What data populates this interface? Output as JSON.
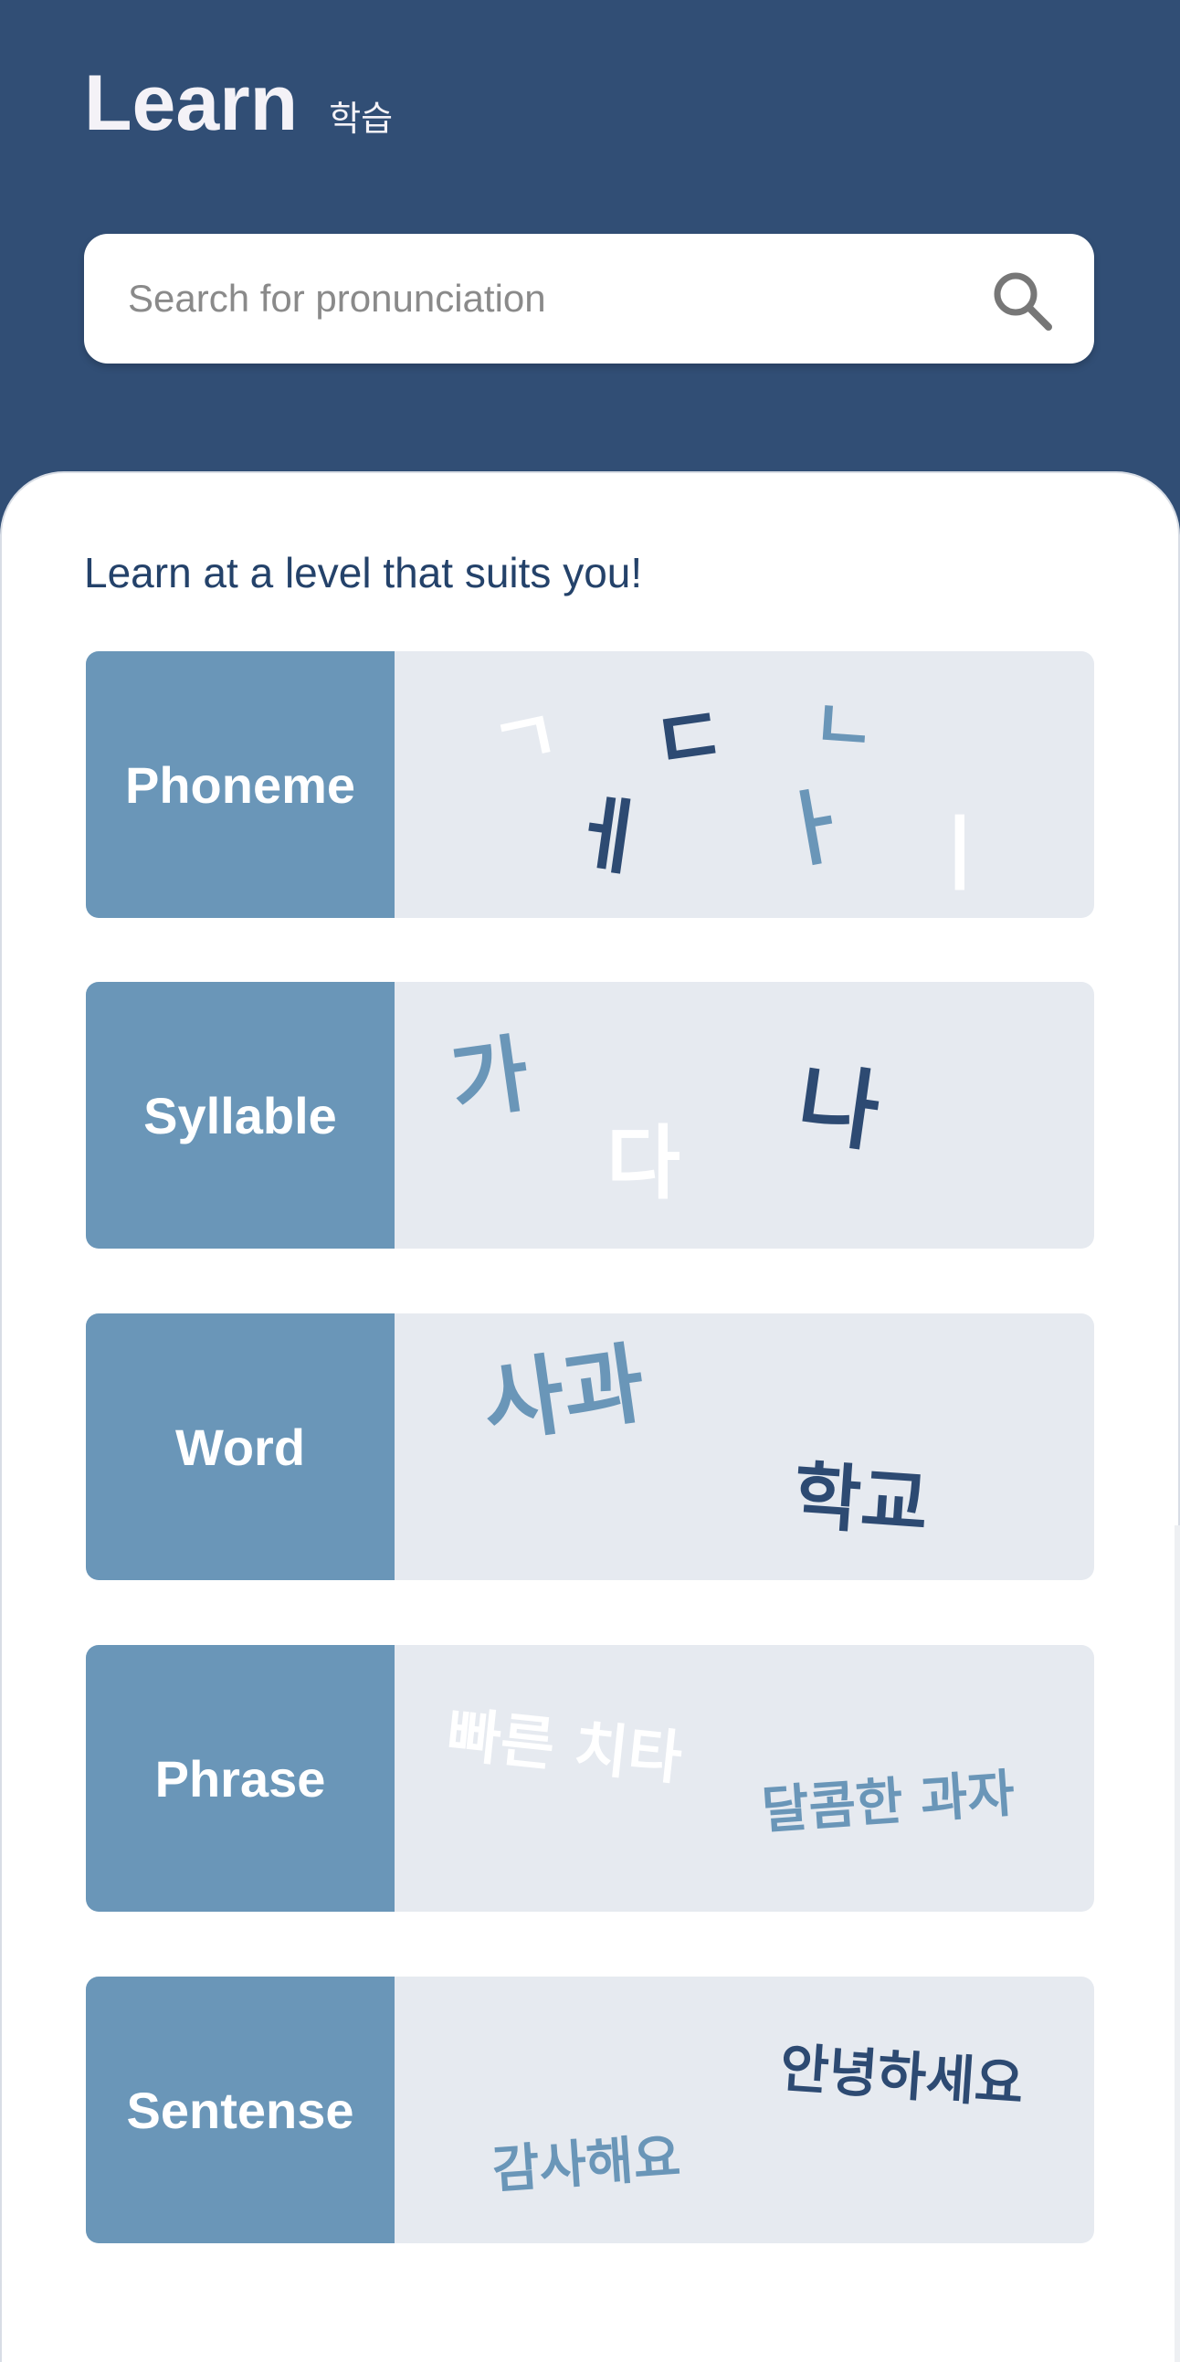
{
  "header": {
    "title": "Learn",
    "title_korean": "학습"
  },
  "search": {
    "placeholder": "Search for pronunciation",
    "icon": "search-icon"
  },
  "subtitle": "Learn at a level that suits you!",
  "cards": [
    {
      "label": "Phoneme",
      "glyphs": [
        "ㄱ",
        "ㄷ",
        "ㄴ",
        "ㅔ",
        "ㅏ",
        "ㅣ"
      ]
    },
    {
      "label": "Syllable",
      "glyphs": [
        "가",
        "다",
        "나"
      ]
    },
    {
      "label": "Word",
      "glyphs": [
        "사과",
        "학교"
      ]
    },
    {
      "label": "Phrase",
      "glyphs": [
        "빠른 치타",
        "달콤한 과자"
      ]
    },
    {
      "label": "Sentense",
      "glyphs": [
        "안녕하세요",
        "감사해요"
      ]
    }
  ],
  "colors": {
    "header_bg": "#314e75",
    "card_label_bg": "#6a96b8",
    "card_bg": "#e6eaf0",
    "glyph_dark": "#2d4a72",
    "glyph_mid": "#6a96b8",
    "glyph_light": "#ffffff"
  }
}
